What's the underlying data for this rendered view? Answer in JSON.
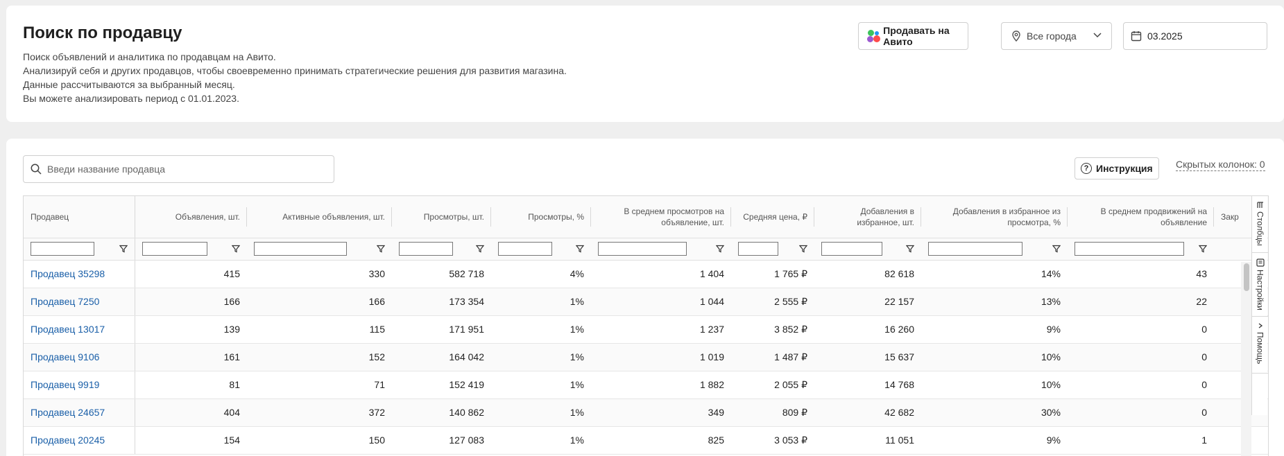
{
  "header": {
    "title": "Поиск по продавцу",
    "description": [
      "Поиск объявлений и аналитика по продавцам на Авито.",
      "Анализируй себя и других продавцов, чтобы своевременно принимать стратегические решения для развития магазина.",
      "Данные рассчитываются за выбранный месяц.",
      "Вы можете анализировать период с 01.01.2023."
    ],
    "sell_button": "Продавать на Авито",
    "city_select": "Все города",
    "date_value": "03.2025"
  },
  "toolbar": {
    "search_placeholder": "Введи название продавца",
    "instruction_button": "Инструкция",
    "hidden_columns": "Скрытых колонок: 0"
  },
  "table": {
    "columns": [
      "Продавец",
      "Объявления, шт.",
      "Активные объявления, шт.",
      "Просмотры, шт.",
      "Просмотры, %",
      "В среднем просмотров на объявление, шт.",
      "Средняя цена, ₽",
      "Добавления в избранное, шт.",
      "Добавления в избранное из просмотра, %",
      "В среднем продвижений на объявление",
      "Закр"
    ],
    "rows": [
      [
        "Продавец 35298",
        "415",
        "330",
        "582 718",
        "4%",
        "1 404",
        "1 765 ₽",
        "82 618",
        "14%",
        "43",
        ""
      ],
      [
        "Продавец 7250",
        "166",
        "166",
        "173 354",
        "1%",
        "1 044",
        "2 555 ₽",
        "22 157",
        "13%",
        "22",
        ""
      ],
      [
        "Продавец 13017",
        "139",
        "115",
        "171 951",
        "1%",
        "1 237",
        "3 852 ₽",
        "16 260",
        "9%",
        "0",
        ""
      ],
      [
        "Продавец 9106",
        "161",
        "152",
        "164 042",
        "1%",
        "1 019",
        "1 487 ₽",
        "15 637",
        "10%",
        "0",
        ""
      ],
      [
        "Продавец 9919",
        "81",
        "71",
        "152 419",
        "1%",
        "1 882",
        "2 055 ₽",
        "14 768",
        "10%",
        "0",
        ""
      ],
      [
        "Продавец 24657",
        "404",
        "372",
        "140 862",
        "1%",
        "349",
        "809 ₽",
        "42 682",
        "30%",
        "0",
        ""
      ],
      [
        "Продавец 20245",
        "154",
        "150",
        "127 083",
        "1%",
        "825",
        "3 053 ₽",
        "11 051",
        "9%",
        "1",
        ""
      ]
    ]
  },
  "side_panel": {
    "tabs": [
      "Столбцы",
      "Настройки",
      "Помощь"
    ]
  },
  "colors": {
    "link": "#1a5fa8",
    "avito_blue": "#2196f3",
    "avito_green": "#3dc35c",
    "avito_red": "#ff4b4b",
    "avito_purple": "#9b59d0"
  }
}
